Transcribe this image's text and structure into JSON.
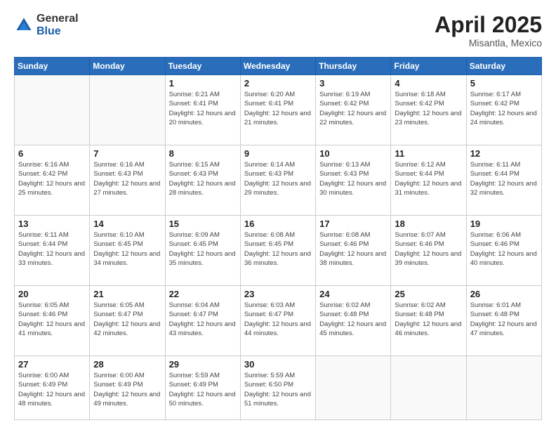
{
  "header": {
    "logo_general": "General",
    "logo_blue": "Blue",
    "month_year": "April 2025",
    "location": "Misantla, Mexico"
  },
  "weekdays": [
    "Sunday",
    "Monday",
    "Tuesday",
    "Wednesday",
    "Thursday",
    "Friday",
    "Saturday"
  ],
  "weeks": [
    [
      {
        "day": "",
        "info": ""
      },
      {
        "day": "",
        "info": ""
      },
      {
        "day": "1",
        "info": "Sunrise: 6:21 AM\nSunset: 6:41 PM\nDaylight: 12 hours and 20 minutes."
      },
      {
        "day": "2",
        "info": "Sunrise: 6:20 AM\nSunset: 6:41 PM\nDaylight: 12 hours and 21 minutes."
      },
      {
        "day": "3",
        "info": "Sunrise: 6:19 AM\nSunset: 6:42 PM\nDaylight: 12 hours and 22 minutes."
      },
      {
        "day": "4",
        "info": "Sunrise: 6:18 AM\nSunset: 6:42 PM\nDaylight: 12 hours and 23 minutes."
      },
      {
        "day": "5",
        "info": "Sunrise: 6:17 AM\nSunset: 6:42 PM\nDaylight: 12 hours and 24 minutes."
      }
    ],
    [
      {
        "day": "6",
        "info": "Sunrise: 6:16 AM\nSunset: 6:42 PM\nDaylight: 12 hours and 25 minutes."
      },
      {
        "day": "7",
        "info": "Sunrise: 6:16 AM\nSunset: 6:43 PM\nDaylight: 12 hours and 27 minutes."
      },
      {
        "day": "8",
        "info": "Sunrise: 6:15 AM\nSunset: 6:43 PM\nDaylight: 12 hours and 28 minutes."
      },
      {
        "day": "9",
        "info": "Sunrise: 6:14 AM\nSunset: 6:43 PM\nDaylight: 12 hours and 29 minutes."
      },
      {
        "day": "10",
        "info": "Sunrise: 6:13 AM\nSunset: 6:43 PM\nDaylight: 12 hours and 30 minutes."
      },
      {
        "day": "11",
        "info": "Sunrise: 6:12 AM\nSunset: 6:44 PM\nDaylight: 12 hours and 31 minutes."
      },
      {
        "day": "12",
        "info": "Sunrise: 6:11 AM\nSunset: 6:44 PM\nDaylight: 12 hours and 32 minutes."
      }
    ],
    [
      {
        "day": "13",
        "info": "Sunrise: 6:11 AM\nSunset: 6:44 PM\nDaylight: 12 hours and 33 minutes."
      },
      {
        "day": "14",
        "info": "Sunrise: 6:10 AM\nSunset: 6:45 PM\nDaylight: 12 hours and 34 minutes."
      },
      {
        "day": "15",
        "info": "Sunrise: 6:09 AM\nSunset: 6:45 PM\nDaylight: 12 hours and 35 minutes."
      },
      {
        "day": "16",
        "info": "Sunrise: 6:08 AM\nSunset: 6:45 PM\nDaylight: 12 hours and 36 minutes."
      },
      {
        "day": "17",
        "info": "Sunrise: 6:08 AM\nSunset: 6:46 PM\nDaylight: 12 hours and 38 minutes."
      },
      {
        "day": "18",
        "info": "Sunrise: 6:07 AM\nSunset: 6:46 PM\nDaylight: 12 hours and 39 minutes."
      },
      {
        "day": "19",
        "info": "Sunrise: 6:06 AM\nSunset: 6:46 PM\nDaylight: 12 hours and 40 minutes."
      }
    ],
    [
      {
        "day": "20",
        "info": "Sunrise: 6:05 AM\nSunset: 6:46 PM\nDaylight: 12 hours and 41 minutes."
      },
      {
        "day": "21",
        "info": "Sunrise: 6:05 AM\nSunset: 6:47 PM\nDaylight: 12 hours and 42 minutes."
      },
      {
        "day": "22",
        "info": "Sunrise: 6:04 AM\nSunset: 6:47 PM\nDaylight: 12 hours and 43 minutes."
      },
      {
        "day": "23",
        "info": "Sunrise: 6:03 AM\nSunset: 6:47 PM\nDaylight: 12 hours and 44 minutes."
      },
      {
        "day": "24",
        "info": "Sunrise: 6:02 AM\nSunset: 6:48 PM\nDaylight: 12 hours and 45 minutes."
      },
      {
        "day": "25",
        "info": "Sunrise: 6:02 AM\nSunset: 6:48 PM\nDaylight: 12 hours and 46 minutes."
      },
      {
        "day": "26",
        "info": "Sunrise: 6:01 AM\nSunset: 6:48 PM\nDaylight: 12 hours and 47 minutes."
      }
    ],
    [
      {
        "day": "27",
        "info": "Sunrise: 6:00 AM\nSunset: 6:49 PM\nDaylight: 12 hours and 48 minutes."
      },
      {
        "day": "28",
        "info": "Sunrise: 6:00 AM\nSunset: 6:49 PM\nDaylight: 12 hours and 49 minutes."
      },
      {
        "day": "29",
        "info": "Sunrise: 5:59 AM\nSunset: 6:49 PM\nDaylight: 12 hours and 50 minutes."
      },
      {
        "day": "30",
        "info": "Sunrise: 5:59 AM\nSunset: 6:50 PM\nDaylight: 12 hours and 51 minutes."
      },
      {
        "day": "",
        "info": ""
      },
      {
        "day": "",
        "info": ""
      },
      {
        "day": "",
        "info": ""
      }
    ]
  ]
}
